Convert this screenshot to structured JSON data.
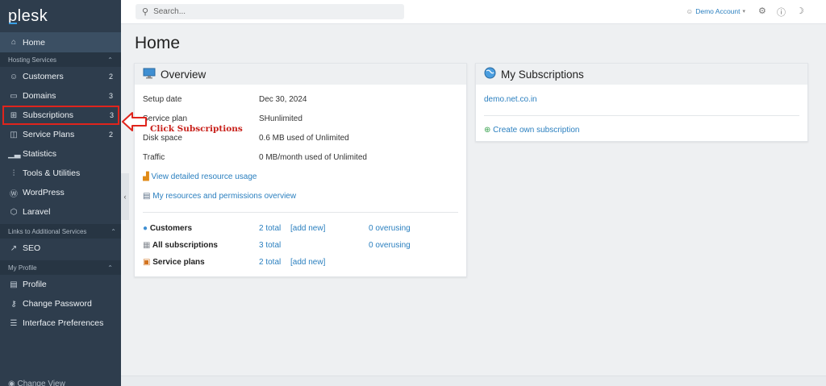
{
  "app": {
    "logo": "plesk"
  },
  "sidebar": {
    "home": "Home",
    "sections": {
      "hosting": "Hosting Services",
      "links": "Links to Additional Services",
      "profile": "My Profile"
    },
    "items": {
      "customers": {
        "label": "Customers",
        "count": "2"
      },
      "domains": {
        "label": "Domains",
        "count": "3"
      },
      "subscriptions": {
        "label": "Subscriptions",
        "count": "3"
      },
      "service_plans": {
        "label": "Service Plans",
        "count": "2"
      },
      "statistics": {
        "label": "Statistics"
      },
      "tools": {
        "label": "Tools & Utilities"
      },
      "wordpress": {
        "label": "WordPress"
      },
      "laravel": {
        "label": "Laravel"
      },
      "seo": {
        "label": "SEO"
      },
      "profile": {
        "label": "Profile"
      },
      "change_password": {
        "label": "Change Password"
      },
      "interface_prefs": {
        "label": "Interface Preferences"
      }
    },
    "bottom": "Change View"
  },
  "topbar": {
    "search_placeholder": "Search...",
    "account": "Demo Account"
  },
  "main": {
    "title": "Home",
    "overview": {
      "title": "Overview",
      "rows": [
        {
          "label": "Setup date",
          "value": "Dec 30, 2024"
        },
        {
          "label": "Service plan",
          "value": "SHunlimited"
        },
        {
          "label": "Disk space",
          "value": "0.6 MB used of Unlimited"
        },
        {
          "label": "Traffic",
          "value": "0 MB/month used of Unlimited"
        }
      ],
      "link_resource_usage": "View detailed resource usage",
      "link_permissions": "My resources and permissions overview",
      "summary": {
        "customers": {
          "label": "Customers",
          "total": "2 total",
          "add": "[add new]",
          "overusing": "0 overusing"
        },
        "subscriptions": {
          "label": "All subscriptions",
          "total": "3 total",
          "overusing": "0 overusing"
        },
        "plans": {
          "label": "Service plans",
          "total": "2 total",
          "add": "[add new]"
        }
      }
    },
    "my_subscriptions": {
      "title": "My Subscriptions",
      "domain": "demo.net.co.in",
      "create": "Create own subscription"
    }
  },
  "annotation": {
    "text": "Click Subscriptions"
  },
  "colors": {
    "sidebar_bg": "#2e3d4d",
    "link": "#2a7fbf",
    "annotation": "#c8201a"
  }
}
